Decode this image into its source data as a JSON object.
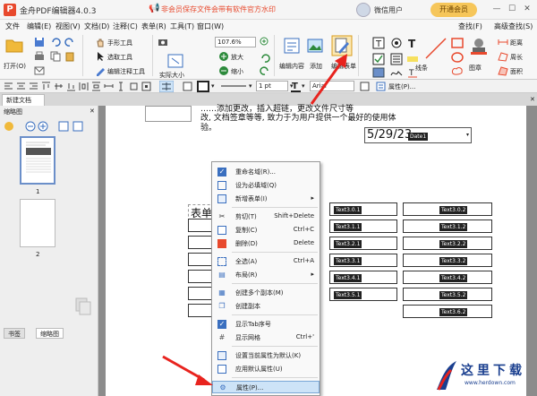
{
  "app": {
    "logo": "P",
    "title": "金舟PDF编辑器4.0.3",
    "promo": "非会员保存文件会带有软件官方水印",
    "user": "微信用户",
    "vip_button": "开通会员",
    "minimize": "—",
    "maximize": "☐",
    "close": "✕"
  },
  "menu": {
    "items": [
      "文件",
      "编辑(E)",
      "视图(V)",
      "文档(D)",
      "注释(C)",
      "表单(R)",
      "工具(T)",
      "窗口(W)"
    ],
    "right": [
      "查找(F)",
      "高级查找(S)"
    ]
  },
  "ribbon": {
    "open": "打开(O)",
    "hand": "手形工具",
    "select": "选取工具",
    "annotate": "编辑注释工具",
    "actual_size": "实际大小",
    "zoom": "107.6%",
    "zoom_in": "放大",
    "zoom_out": "缩小",
    "edit_content": "编辑内容",
    "add": "添加",
    "edit_form": "编辑表单",
    "lines": "线条",
    "stamp": "图章",
    "distance": "距离",
    "perimeter": "周长",
    "area": "面积"
  },
  "toolbar2": {
    "line_width": "1 pt",
    "font": "Arial",
    "properties": "属性(P)..."
  },
  "tabs": {
    "doc": "新建文档"
  },
  "leftpanel": {
    "title": "缩略图",
    "pages": [
      "1",
      "2"
    ],
    "tabs": [
      "书签",
      "缩略图"
    ]
  },
  "doc": {
    "line1": "……添加更改，插入超链，更改文件尺寸等",
    "line2": "改, 文档签章等等, 致力于为用户提供一个最好的使用体",
    "line3": "验。",
    "date_value": "5/29/23",
    "date_field": "Date1",
    "form_title": "表单",
    "col1": [
      "Text3.0.1",
      "Text3.1.1",
      "Text3.2.1",
      "Text3.3.1",
      "Text3.4.1",
      "Text3.5.1"
    ],
    "col2": [
      "Text3.0.2",
      "Text3.1.2",
      "Text3.2.2",
      "Text3.3.2",
      "Text3.4.2",
      "Text3.5.2",
      "Text3.6.2"
    ]
  },
  "context_menu": {
    "items": [
      {
        "label": "重命名域(R)...",
        "shortcut": ""
      },
      {
        "label": "设为必填域(Q)",
        "shortcut": ""
      },
      {
        "label": "新增表单(I)",
        "shortcut": "▸"
      },
      {
        "label": "剪切(T)",
        "shortcut": "Shift+Delete"
      },
      {
        "label": "复制(C)",
        "shortcut": "Ctrl+C"
      },
      {
        "label": "删除(D)",
        "shortcut": "Delete"
      },
      {
        "label": "全选(A)",
        "shortcut": "Ctrl+A"
      },
      {
        "label": "布局(R)",
        "shortcut": "▸"
      },
      {
        "label": "创建多个副本(M)",
        "shortcut": ""
      },
      {
        "label": "创建副本",
        "shortcut": ""
      },
      {
        "label": "显示Tab序号",
        "shortcut": ""
      },
      {
        "label": "显示网格",
        "shortcut": "Ctrl+'"
      },
      {
        "label": "设置当前属性为默认(K)",
        "shortcut": ""
      },
      {
        "label": "应用默认属性(U)",
        "shortcut": ""
      },
      {
        "label": "属性(P)...",
        "shortcut": ""
      }
    ]
  },
  "watermark": {
    "name": "这里下载",
    "url": "www.herdown.com"
  },
  "colors": {
    "accent": "#e8492d",
    "highlight": "#cde3f7",
    "brand": "#1a3f8f"
  }
}
